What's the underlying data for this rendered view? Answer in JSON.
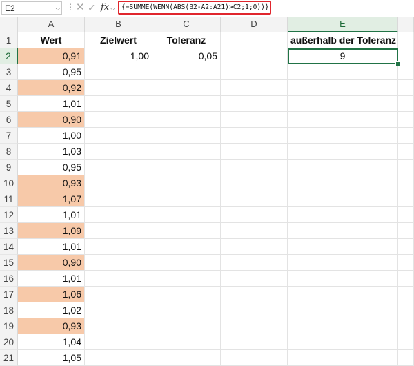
{
  "formula_bar": {
    "name_box": "E2",
    "formula": "{=SUMME(WENN(ABS(B2-A2:A21)>C2;1;0))}",
    "fx": "fx"
  },
  "columns": [
    "A",
    "B",
    "C",
    "D",
    "E"
  ],
  "rows": [
    "1",
    "2",
    "3",
    "4",
    "5",
    "6",
    "7",
    "8",
    "9",
    "10",
    "11",
    "12",
    "13",
    "14",
    "15",
    "16",
    "17",
    "18",
    "19",
    "20",
    "21"
  ],
  "headers": {
    "A1": "Wert",
    "B1": "Zielwert",
    "C1": "Toleranz",
    "E1": "außerhalb der Toleranz"
  },
  "values": {
    "B2": "1,00",
    "C2": "0,05",
    "E2": "9"
  },
  "wert": [
    "0,91",
    "0,95",
    "0,92",
    "1,01",
    "0,90",
    "1,00",
    "1,03",
    "0,95",
    "0,93",
    "1,07",
    "1,01",
    "1,09",
    "1,01",
    "0,90",
    "1,01",
    "1,06",
    "1,02",
    "0,93",
    "1,04",
    "1,05"
  ],
  "highlighted_rows": [
    2,
    4,
    6,
    10,
    11,
    13,
    15,
    17,
    19
  ],
  "colors": {
    "highlight": "#f7c9a9",
    "selection": "#217346",
    "formula_border": "#e0262d"
  }
}
